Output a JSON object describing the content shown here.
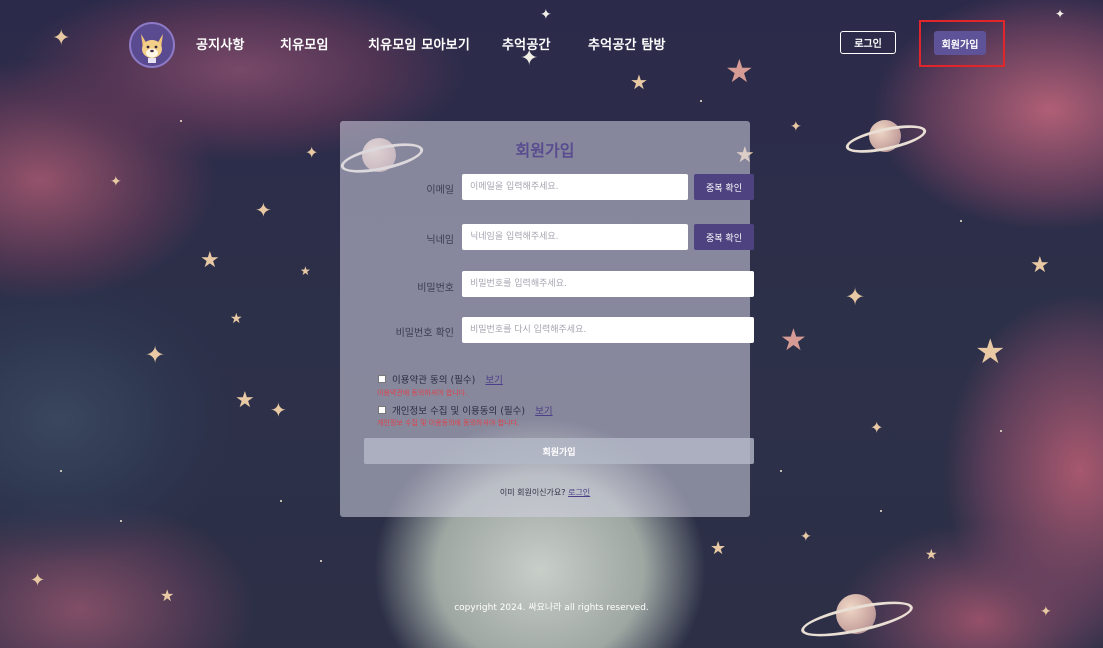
{
  "nav": {
    "items": [
      {
        "label": "공지사항"
      },
      {
        "label": "치유모임"
      },
      {
        "label": "치유모임 모아보기"
      },
      {
        "label": "추억공간"
      },
      {
        "label": "추억공간 탐방"
      }
    ],
    "login_label": "로그인",
    "signup_label": "회원가입",
    "logo_icon": "dog-face-icon"
  },
  "form": {
    "title": "회원가입",
    "email": {
      "label": "이메일",
      "placeholder": "이메일을 입력해주세요.",
      "button": "중복 확인"
    },
    "nickname": {
      "label": "닉네임",
      "placeholder": "닉네임을 입력해주세요.",
      "button": "중복 확인"
    },
    "password": {
      "label": "비밀번호",
      "placeholder": "비밀번호를 입력해주세요."
    },
    "password_confirm": {
      "label": "비밀번호 확인",
      "placeholder": "비밀번호를 다시 입력해주세요."
    },
    "terms": {
      "label": "이용약관 동의 (필수)",
      "view": "보기",
      "error": "이용약관에 동의하셔야 합니다."
    },
    "privacy": {
      "label": "개인정보 수집 및 이용동의 (필수)",
      "view": "보기",
      "error": "개인정보 수집 및 이용동의에 동의하셔야 합니다."
    },
    "submit": "회원가입",
    "already_text": "이미 회원이신가요?",
    "already_link": "로그인"
  },
  "footer": {
    "text": "copyright 2024. 싸요나라 all rights reserved."
  },
  "colors": {
    "accent": "#4e4281",
    "highlight_border": "#e0262b",
    "error": "#e0404a"
  }
}
